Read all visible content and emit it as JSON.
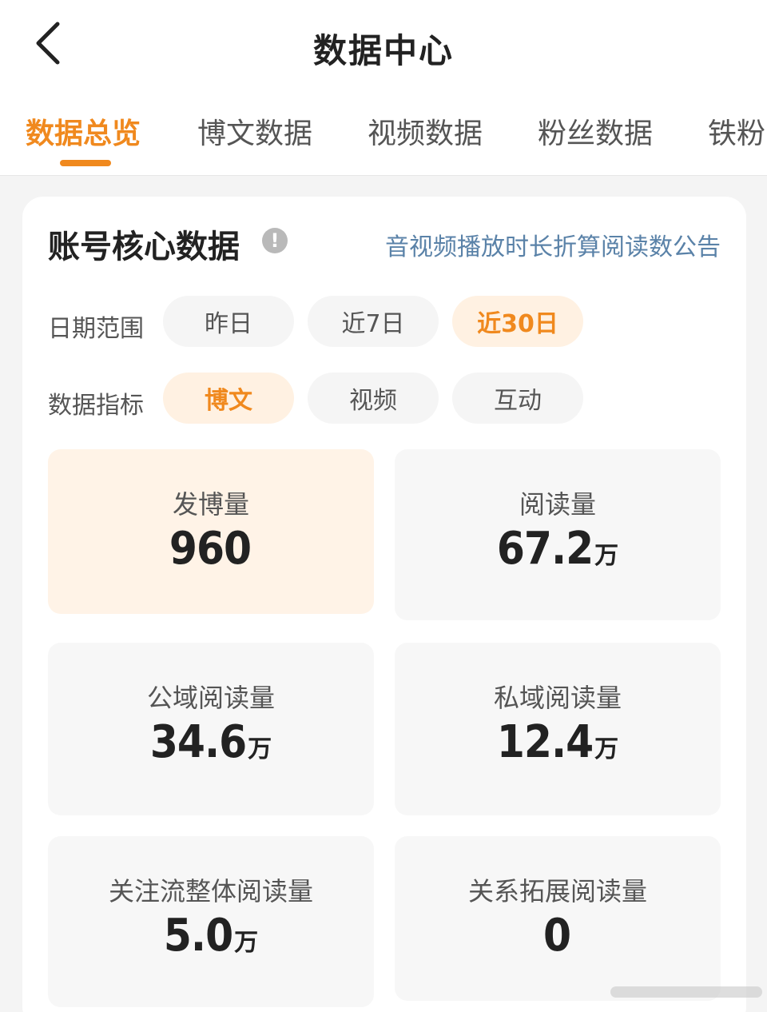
{
  "header": {
    "title": "数据中心",
    "back_icon": "chevron-left-icon"
  },
  "tabs": [
    {
      "label": "数据总览",
      "active": true
    },
    {
      "label": "博文数据",
      "active": false
    },
    {
      "label": "视频数据",
      "active": false
    },
    {
      "label": "粉丝数据",
      "active": false
    },
    {
      "label": "铁粉",
      "active": false
    }
  ],
  "accent_color": "#f0891e",
  "core": {
    "title": "账号核心数据",
    "info_icon": "exclamation-circle-icon",
    "notice_link": "音视频播放时长折算阅读数公告"
  },
  "date_range": {
    "label": "日期范围",
    "options": [
      {
        "label": "昨日",
        "active": false
      },
      {
        "label": "近7日",
        "active": false
      },
      {
        "label": "近30日",
        "active": true
      }
    ]
  },
  "metric_type": {
    "label": "数据指标",
    "options": [
      {
        "label": "博文",
        "active": true
      },
      {
        "label": "视频",
        "active": false
      },
      {
        "label": "互动",
        "active": false
      }
    ]
  },
  "metrics": [
    {
      "label": "发博量",
      "value": "960",
      "unit": "",
      "active": true
    },
    {
      "label": "阅读量",
      "value": "67.2",
      "unit": "万",
      "active": false
    },
    {
      "label": "公域阅读量",
      "value": "34.6",
      "unit": "万",
      "active": false
    },
    {
      "label": "私域阅读量",
      "value": "12.4",
      "unit": "万",
      "active": false
    },
    {
      "label": "关注流整体阅读量",
      "value": "5.0",
      "unit": "万",
      "active": false
    },
    {
      "label": "关系拓展阅读量",
      "value": "0",
      "unit": "",
      "active": false
    }
  ]
}
